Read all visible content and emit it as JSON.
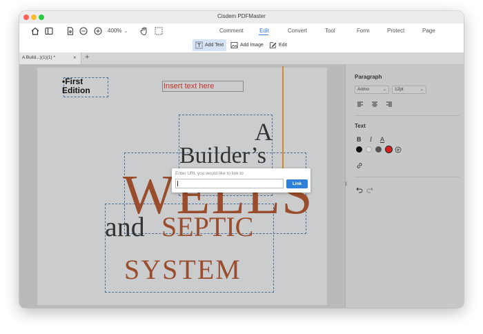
{
  "window": {
    "title": "Cisdem PDFMaster"
  },
  "toolbar": {
    "zoom": "400%",
    "nav": [
      "Comment",
      "Edit",
      "Convert",
      "Tool",
      "Form",
      "Protect",
      "Page"
    ],
    "sub": {
      "add_text": "Add Text",
      "add_image": "Add Image",
      "edit": "Edit"
    }
  },
  "tabs": {
    "doc_tab": "A Build...)(1)(1) *",
    "close": "×",
    "add": "+"
  },
  "page": {
    "first_edition_1": "•First",
    "first_edition_2": "Edition",
    "insert_text": "Insert text here",
    "a": "A",
    "builders": "Builder’s",
    "wells": "WELLS",
    "and": "and",
    "septic": "SEPTIC",
    "system": "SYSTEM"
  },
  "dialog": {
    "label": "Enter URL you would like to link to",
    "button": "Link"
  },
  "panel": {
    "paragraph": "Paragraph",
    "font": "Arimo",
    "size": "12pt",
    "text": "Text",
    "bold": "B",
    "italic": "I",
    "underline": "A"
  },
  "colors": {
    "accent": "#3a7be0",
    "brown": "#9a4d2c",
    "red": "#c4322a",
    "swatches": [
      "#111111",
      "#d8d8d8",
      "#555555",
      "#d81e1e"
    ]
  }
}
